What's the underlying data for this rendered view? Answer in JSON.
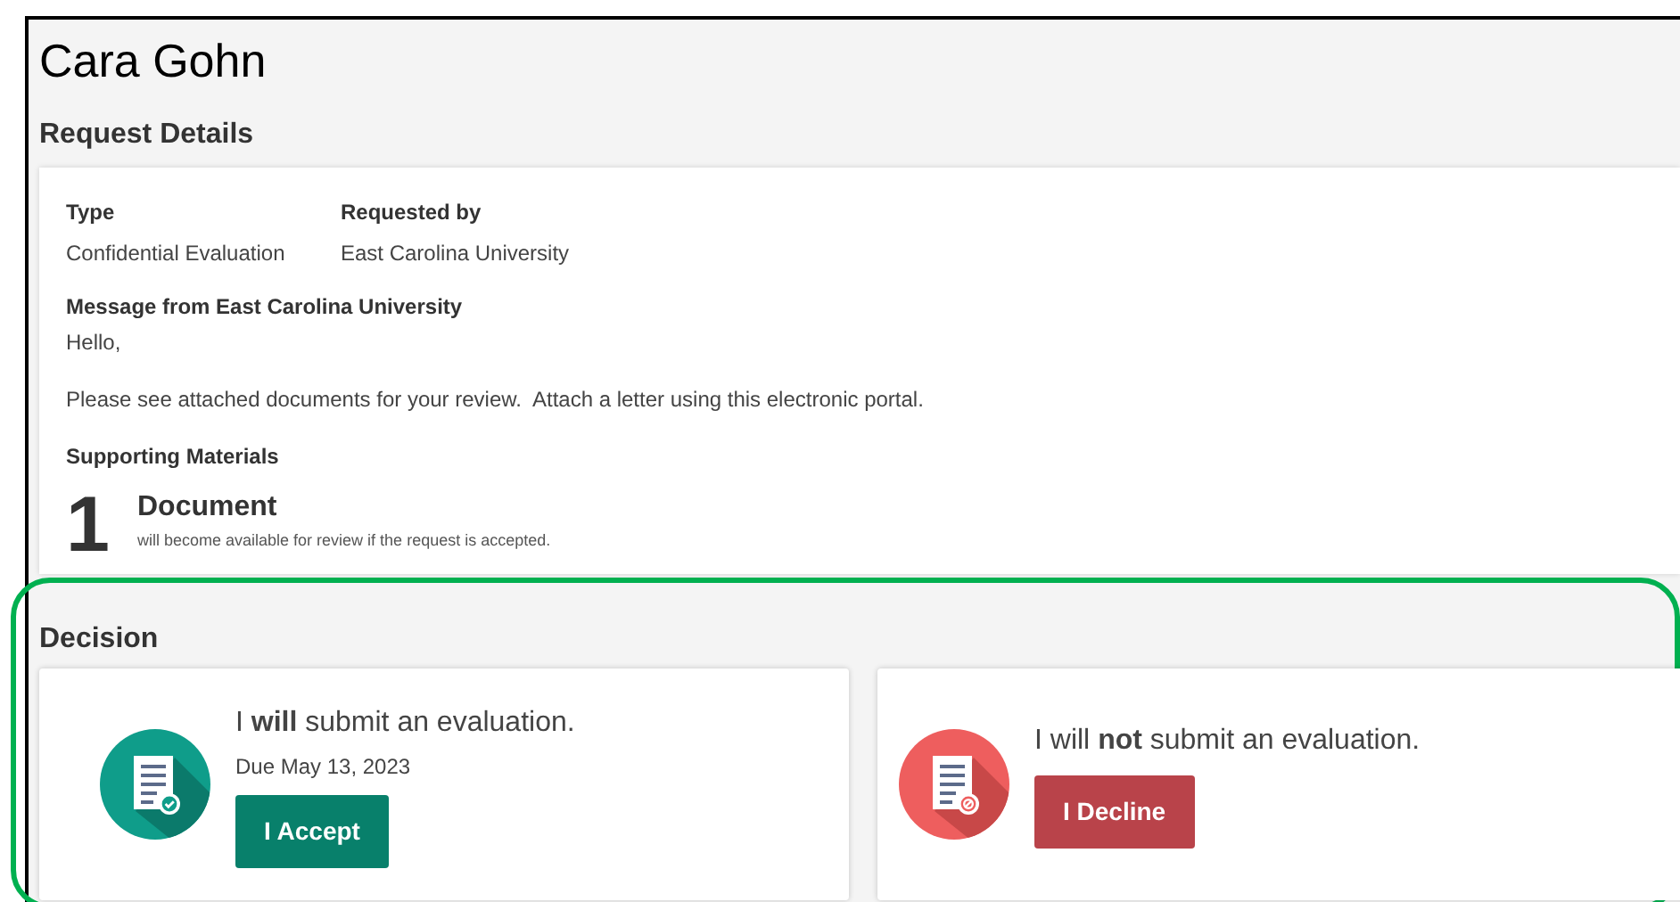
{
  "person_name": "Cara Gohn",
  "request_details": {
    "heading": "Request Details",
    "fields": [
      {
        "label": "Type",
        "value": "Confidential Evaluation"
      },
      {
        "label": "Requested by",
        "value": "East Carolina University"
      }
    ],
    "message": {
      "label": "Message from East Carolina University",
      "lines": [
        "Hello,",
        "Please see attached documents for your review.  Attach a letter using this electronic portal."
      ]
    },
    "supporting_materials": {
      "label": "Supporting Materials",
      "count": "1",
      "title": "Document",
      "note": "will become available for review if the request is accepted."
    }
  },
  "decision": {
    "heading": "Decision",
    "options": [
      {
        "kind": "accept",
        "statement": "I **will** submit an evaluation.",
        "due": "Due May 13, 2023",
        "button": "I Accept"
      },
      {
        "kind": "decline",
        "statement": "I will **not** submit an evaluation.",
        "button": "I Decline"
      }
    ]
  }
}
